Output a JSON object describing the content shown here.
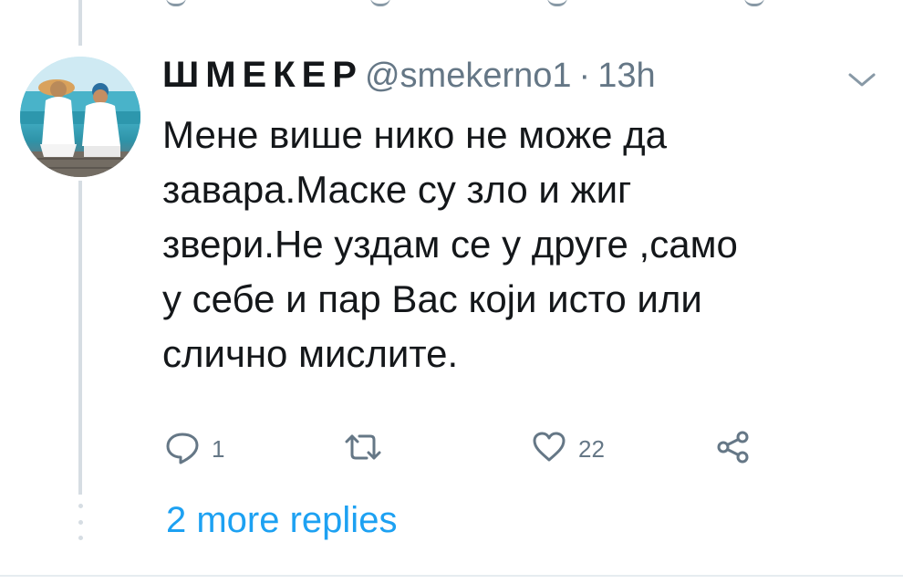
{
  "tweet": {
    "display_name": "ШМЕКЕР",
    "handle": "@smekerno1",
    "separator": "·",
    "time": "13h",
    "text_lines": [
      "Мене више нико не може да",
      "завара.Маске су зло и жиг",
      "звери.Не уздам се у друге ,само",
      "у себе и пар Вас који исто или",
      "слично мислите."
    ],
    "actions": {
      "reply_count": "1",
      "retweet_count": "",
      "like_count": "22"
    }
  },
  "thread": {
    "more_replies_label": "2 more replies"
  },
  "colors": {
    "text_primary": "#14171a",
    "text_secondary": "#657786",
    "link_blue": "#1da1f2",
    "thread_line": "#d6dde3"
  },
  "icons": {
    "reply": "reply-icon",
    "retweet": "retweet-icon",
    "like": "heart-icon",
    "share": "share-icon",
    "menu": "chevron-down-icon"
  }
}
